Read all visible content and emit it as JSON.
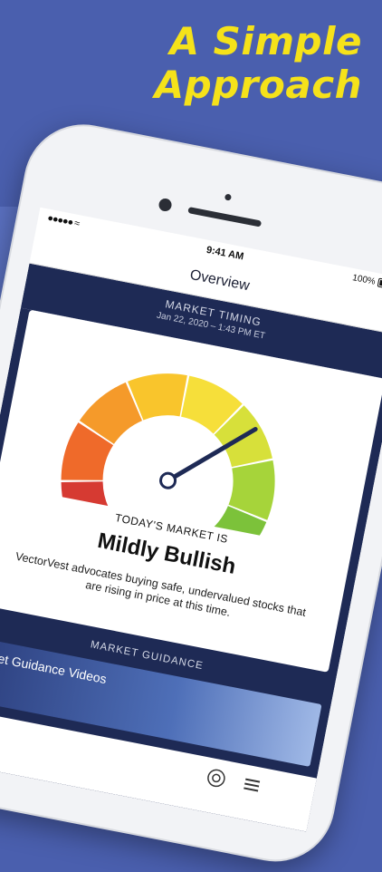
{
  "headline": {
    "line1": "A Simple",
    "line2": "Approach"
  },
  "status_bar": {
    "signal": "●●●●● ≈",
    "time": "9:41 AM",
    "battery": "100%"
  },
  "nav": {
    "title": "Overview"
  },
  "market_timing": {
    "label": "MARKET TIMING",
    "date": "Jan 22, 2020 – 1:43 PM ET"
  },
  "gauge": {
    "level": 0.68,
    "colors": [
      "#d63a32",
      "#ef6a2a",
      "#f59a2a",
      "#f9c52c",
      "#f6df3a",
      "#d7e03a",
      "#a6d43a",
      "#7cc23a"
    ]
  },
  "market": {
    "label": "TODAY'S MARKET IS",
    "status": "Mildly Bullish",
    "description": "VectorVest advocates buying safe, undervalued stocks that are rising in price at this time."
  },
  "guidance": {
    "label": "MARKET GUIDANCE",
    "video_title": "Market Guidance Videos"
  },
  "icons": {
    "search": "search-icon",
    "target": "target-icon",
    "menu": "menu-icon"
  }
}
